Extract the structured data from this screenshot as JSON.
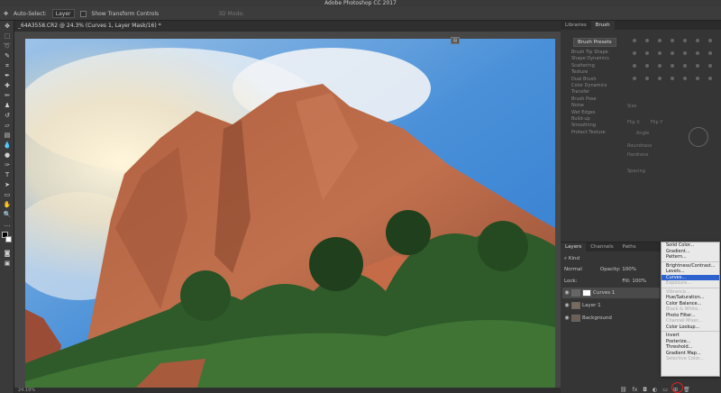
{
  "app": {
    "title": "Adobe Photoshop CC 2017"
  },
  "options_bar": {
    "auto_select_label": "Auto-Select:",
    "auto_select_value": "Layer",
    "show_transform_label": "Show Transform Controls",
    "mode_3d": "3D Mode:"
  },
  "document": {
    "tab_title": "_64A3558.CR2 @ 24.3% (Curves 1, Layer Mask/16) *",
    "zoom": "24.19%"
  },
  "panels": {
    "top_tabs": [
      "Libraries",
      "Brush"
    ],
    "brush_presets_button": "Brush Presets",
    "brush_options": [
      "Brush Tip Shape",
      "Shape Dynamics",
      "Scattering",
      "Texture",
      "Dual Brush",
      "Color Dynamics",
      "Transfer",
      "Brush Pose",
      "Noise",
      "Wet Edges",
      "Build-up",
      "Smoothing",
      "Protect Texture"
    ],
    "brush_props": {
      "size": "Size",
      "flip_x": "Flip X",
      "flip_y": "Flip Y",
      "angle": "Angle",
      "roundness": "Roundness",
      "hardness": "Hardness",
      "spacing": "Spacing"
    }
  },
  "layers": {
    "tabs": [
      "Layers",
      "Channels",
      "Paths"
    ],
    "kind_filter": "Kind",
    "blend_mode": "Normal",
    "opacity_label": "Opacity:",
    "opacity_value": "100%",
    "lock_label": "Lock:",
    "fill_label": "Fill:",
    "fill_value": "100%",
    "items": [
      {
        "name": "Curves 1"
      },
      {
        "name": "Layer 1"
      },
      {
        "name": "Background"
      }
    ]
  },
  "adjustment_menu": {
    "groups": [
      [
        "Solid Color...",
        "Gradient...",
        "Pattern..."
      ],
      [
        "Brightness/Contrast...",
        "Levels...",
        "Curves...",
        "Exposure..."
      ],
      [
        "Vibrance...",
        "Hue/Saturation...",
        "Color Balance...",
        "Black & White...",
        "Photo Filter...",
        "Channel Mixer...",
        "Color Lookup..."
      ],
      [
        "Invert",
        "Posterize...",
        "Threshold...",
        "Gradient Map...",
        "Selective Color..."
      ]
    ],
    "highlighted": "Curves...",
    "disabled": [
      "Exposure...",
      "Vibrance...",
      "Black & White...",
      "Channel Mixer...",
      "Selective Color..."
    ]
  },
  "colors": {
    "highlight": "#2d62cf",
    "annotation_circle": "#dd2222"
  }
}
